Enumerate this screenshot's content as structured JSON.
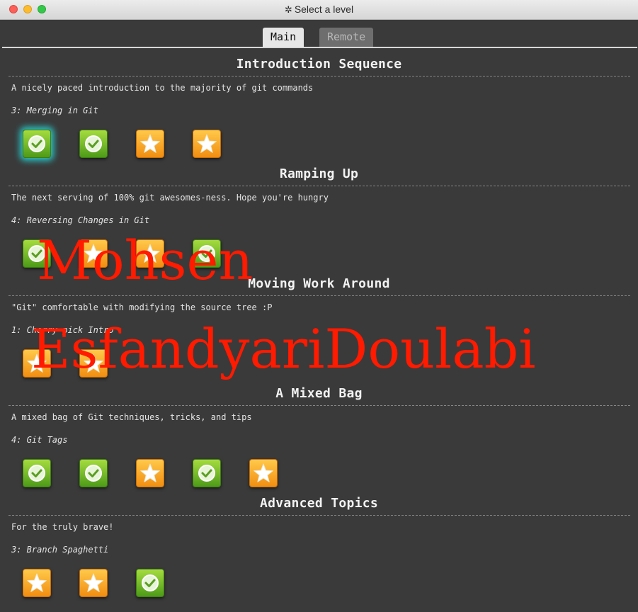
{
  "window": {
    "title": "Select a level",
    "title_icon": "gear-icon"
  },
  "tabs": [
    {
      "label": "Main",
      "active": true
    },
    {
      "label": "Remote",
      "active": false
    }
  ],
  "sequences": [
    {
      "title": "Introduction Sequence",
      "about": "A nicely paced introduction to the majority of git commands",
      "current": "3: Merging in Git",
      "levels": [
        "check",
        "check",
        "star",
        "star"
      ],
      "selected_index": 0
    },
    {
      "title": "Ramping Up",
      "about": "The next serving of 100% git awesomes-ness. Hope you're hungry",
      "current": "4: Reversing Changes in Git",
      "levels": [
        "check",
        "star",
        "star",
        "check"
      ],
      "selected_index": -1
    },
    {
      "title": "Moving Work Around",
      "about": "\"Git\" comfortable with modifying the source tree :P",
      "current": "1: Cherry-pick Intro",
      "levels": [
        "star",
        "star"
      ],
      "selected_index": -1
    },
    {
      "title": "A Mixed Bag",
      "about": "A mixed bag of Git techniques, tricks, and tips",
      "current": "4: Git Tags",
      "levels": [
        "check",
        "check",
        "star",
        "check",
        "star"
      ],
      "selected_index": -1
    },
    {
      "title": "Advanced Topics",
      "about": "For the truly brave!",
      "current": "3: Branch Spaghetti",
      "levels": [
        "star",
        "star",
        "check"
      ],
      "selected_index": -1
    }
  ],
  "watermark": {
    "line1": "Mohsen",
    "line2": "EsfandyariDoulabi"
  },
  "colors": {
    "background": "#3a3a3a",
    "check_icon": "#5fae1f",
    "star_icon": "#f7a21f",
    "selected_glow": "#28dcdc",
    "watermark": "#ff1a00"
  }
}
